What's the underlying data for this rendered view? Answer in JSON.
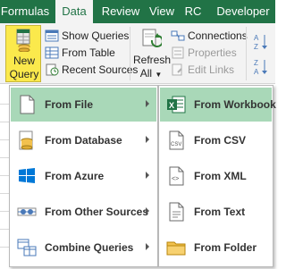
{
  "tabs": [
    {
      "label": "Formulas",
      "active": false
    },
    {
      "label": "Data",
      "active": true
    },
    {
      "label": "Review",
      "active": false
    },
    {
      "label": "View",
      "active": false
    },
    {
      "label": "RC",
      "active": false
    },
    {
      "label": "Developer",
      "active": false
    }
  ],
  "ribbon": {
    "new_query_line1": "New",
    "new_query_line2": "Query",
    "show_queries": "Show Queries",
    "from_table": "From Table",
    "recent_sources": "Recent Sources",
    "refresh_line1": "Refresh",
    "refresh_line2": "All",
    "connections": "Connections",
    "properties": "Properties",
    "edit_links": "Edit Links"
  },
  "menu": {
    "items": [
      {
        "label": "From File",
        "icon": "file-icon",
        "highlighted": true,
        "submenu": true
      },
      {
        "label": "From Database",
        "icon": "database-icon",
        "highlighted": false,
        "submenu": true
      },
      {
        "label": "From Azure",
        "icon": "azure-icon",
        "highlighted": false,
        "submenu": true
      },
      {
        "label": "From Other Sources",
        "icon": "other-sources-icon",
        "highlighted": false,
        "submenu": true
      },
      {
        "label": "Combine Queries",
        "icon": "combine-icon",
        "highlighted": false,
        "submenu": true
      }
    ]
  },
  "submenu": {
    "items": [
      {
        "label": "From Workbook",
        "icon": "excel-workbook-icon",
        "highlighted": true
      },
      {
        "label": "From CSV",
        "icon": "csv-file-icon",
        "highlighted": false
      },
      {
        "label": "From XML",
        "icon": "xml-file-icon",
        "highlighted": false
      },
      {
        "label": "From Text",
        "icon": "text-file-icon",
        "highlighted": false
      },
      {
        "label": "From Folder",
        "icon": "folder-icon",
        "highlighted": false
      }
    ]
  },
  "colors": {
    "accent": "#217346",
    "new_query_highlight": "#fbe94c",
    "menu_highlight": "#a9d8b8"
  }
}
